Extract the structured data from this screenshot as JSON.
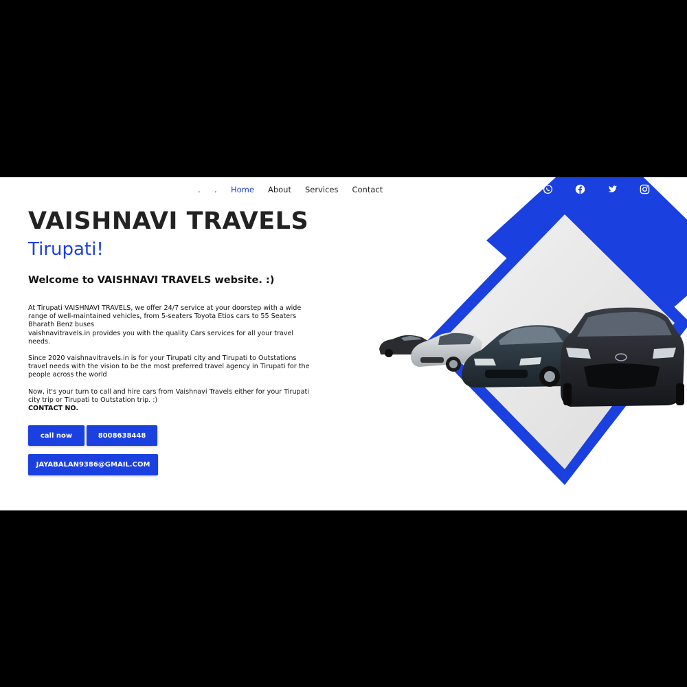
{
  "nav": {
    "dots": [
      ".",
      "."
    ],
    "links": [
      "Home",
      "About",
      "Services",
      "Contact"
    ],
    "active_link": "Home"
  },
  "social": {
    "icons": [
      "whatsapp-icon",
      "facebook-icon",
      "twitter-icon",
      "instagram-icon"
    ]
  },
  "hero": {
    "title": "VAISHNAVI TRAVELS",
    "subtitle": "Tirupati!",
    "welcome": "Welcome to VAISHNAVI TRAVELS website. :)"
  },
  "body": {
    "para1_line1": "At Tirupati VAISHNAVI TRAVELS, we offer 24/7 service at your doorstep with a wide range of well-maintained vehicles, from 5-seaters Toyota Etios cars to 55 Seaters Bharath Benz buses",
    "para1_line2": "vaishnavitravels.in provides you with the quality Cars services for all your travel needs.",
    "para2": "Since 2020 vaishnavitravels.in is for your Tirupati city and Tirupati to Outstations travel needs with the vision to be the most preferred travel agency in Tirupati for the people across the world",
    "para3": "Now, it's your turn to call and hire cars from Vaishnavi Travels either for your Tirupati city trip or Tirupati to Outstation trip. :)",
    "contact_label": "CONTACT NO."
  },
  "buttons": {
    "call": "call now",
    "phone": "8008638448",
    "email": "JAYABALAN9386@GMAIL.COM"
  },
  "colors": {
    "accent": "#1a40e0",
    "background": "#ffffff",
    "frame": "#000000"
  }
}
